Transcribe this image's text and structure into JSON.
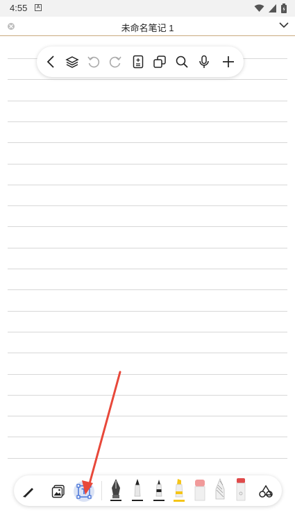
{
  "status": {
    "time": "4:55",
    "notif": "A"
  },
  "document": {
    "title": "未命名笔记 1"
  },
  "icons": {
    "back": "chevron-left-icon",
    "layers": "layers-icon",
    "undo": "undo-icon",
    "redo": "redo-icon",
    "page": "page-icon",
    "copy": "copy-icon",
    "search": "search-icon",
    "mic": "mic-icon",
    "add": "plus-icon"
  },
  "colors": {
    "accent": "#3b6bd6",
    "arrow": "#e8483a",
    "highlighter": "#f5c518",
    "eraser": "#f19a9a",
    "marker_red": "#e04a4a",
    "title_border": "#c8a97e"
  }
}
